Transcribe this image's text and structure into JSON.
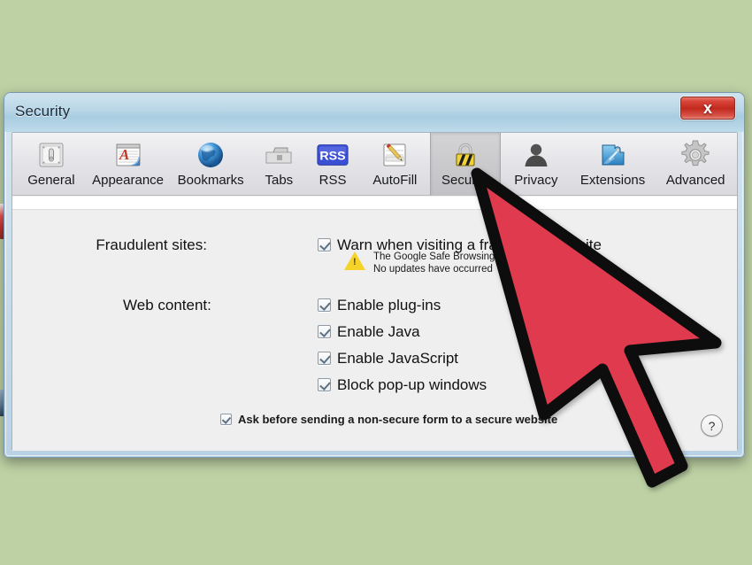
{
  "window": {
    "title": "Security",
    "close_label": "x",
    "help_label": "?"
  },
  "toolbar": {
    "tabs": [
      {
        "label": "General",
        "icon": "general-icon",
        "selected": false
      },
      {
        "label": "Appearance",
        "icon": "appearance-icon",
        "selected": false
      },
      {
        "label": "Bookmarks",
        "icon": "bookmarks-icon",
        "selected": false
      },
      {
        "label": "Tabs",
        "icon": "tabs-icon",
        "selected": false
      },
      {
        "label": "RSS",
        "icon": "rss-icon",
        "selected": false
      },
      {
        "label": "AutoFill",
        "icon": "autofill-icon",
        "selected": false
      },
      {
        "label": "Security",
        "icon": "lock-icon",
        "selected": true
      },
      {
        "label": "Privacy",
        "icon": "person-icon",
        "selected": false
      },
      {
        "label": "Extensions",
        "icon": "puzzle-icon",
        "selected": false
      },
      {
        "label": "Advanced",
        "icon": "gear-icon",
        "selected": false
      }
    ]
  },
  "content": {
    "fraudulent_sites": {
      "label": "Fraudulent sites:",
      "checkbox_label": "Warn when visiting a fraudulent website",
      "checked": true,
      "warning_line1": "The Google Safe Browsing service",
      "warning_line2": "No updates have occurred"
    },
    "web_content": {
      "label": "Web content:",
      "items": [
        {
          "label": "Enable plug-ins",
          "checked": true
        },
        {
          "label": "Enable Java",
          "checked": true
        },
        {
          "label": "Enable JavaScript",
          "checked": true
        },
        {
          "label": "Block pop-up windows",
          "checked": true
        }
      ]
    },
    "secure_form": {
      "label": "Ask before sending a non-secure form to a secure website",
      "checked": true
    }
  },
  "colors": {
    "desktop_background": "#bdd1a4",
    "titlebar_top": "#cfe3ef",
    "titlebar_bottom": "#bedbea",
    "content_background": "#efefef",
    "close_button": "#c2291e",
    "cursor_fill": "#e03a4e",
    "cursor_stroke": "#0d0d0d",
    "warning_icon": "#f5d328"
  }
}
